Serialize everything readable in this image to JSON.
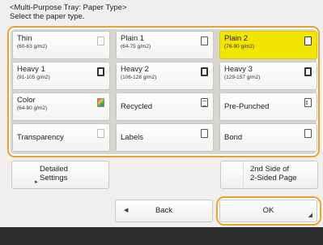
{
  "header": {
    "title": "<Multi-Purpose Tray: Paper Type>",
    "instruction": "Select the paper type."
  },
  "paper_types": [
    {
      "name": "Thin",
      "sub": "(60-63 g/m2)",
      "icon": "paper-icon",
      "selected": false
    },
    {
      "name": "Plain 1",
      "sub": "(64-75 g/m2)",
      "icon": "paper-icon",
      "selected": false
    },
    {
      "name": "Plain 2",
      "sub": "(76-90 g/m2)",
      "icon": "paper-icon",
      "selected": true
    },
    {
      "name": "Heavy 1",
      "sub": "(91-105 g/m2)",
      "icon": "heavy-paper-icon",
      "selected": false
    },
    {
      "name": "Heavy 2",
      "sub": "(106-128 g/m2)",
      "icon": "heavy-paper-icon",
      "selected": false
    },
    {
      "name": "Heavy 3",
      "sub": "(129-157 g/m2)",
      "icon": "heavy-paper-icon",
      "selected": false
    },
    {
      "name": "Color",
      "sub": "(64-80 g/m2)",
      "icon": "color-paper-icon",
      "selected": false
    },
    {
      "name": "Recycled",
      "sub": "",
      "icon": "recycled-paper-icon",
      "selected": false
    },
    {
      "name": "Pre-Punched",
      "sub": "",
      "icon": "punched-paper-icon",
      "selected": false
    },
    {
      "name": "Transparency",
      "sub": "",
      "icon": "transparency-icon",
      "selected": false
    },
    {
      "name": "Labels",
      "sub": "",
      "icon": "labels-icon",
      "selected": false
    },
    {
      "name": "Bond",
      "sub": "",
      "icon": "bond-paper-icon",
      "selected": false
    }
  ],
  "buttons": {
    "detailed_settings": "Detailed Settings",
    "detailed_line1": "Detailed",
    "detailed_line2": "Settings",
    "second_side_line1": "2nd Side of",
    "second_side_line2": "2-Sided Page",
    "back": "Back",
    "ok": "OK"
  },
  "colors": {
    "selected": "#f2e600",
    "focus_outline": "#f0a030",
    "footer": "#2c2c2c"
  }
}
